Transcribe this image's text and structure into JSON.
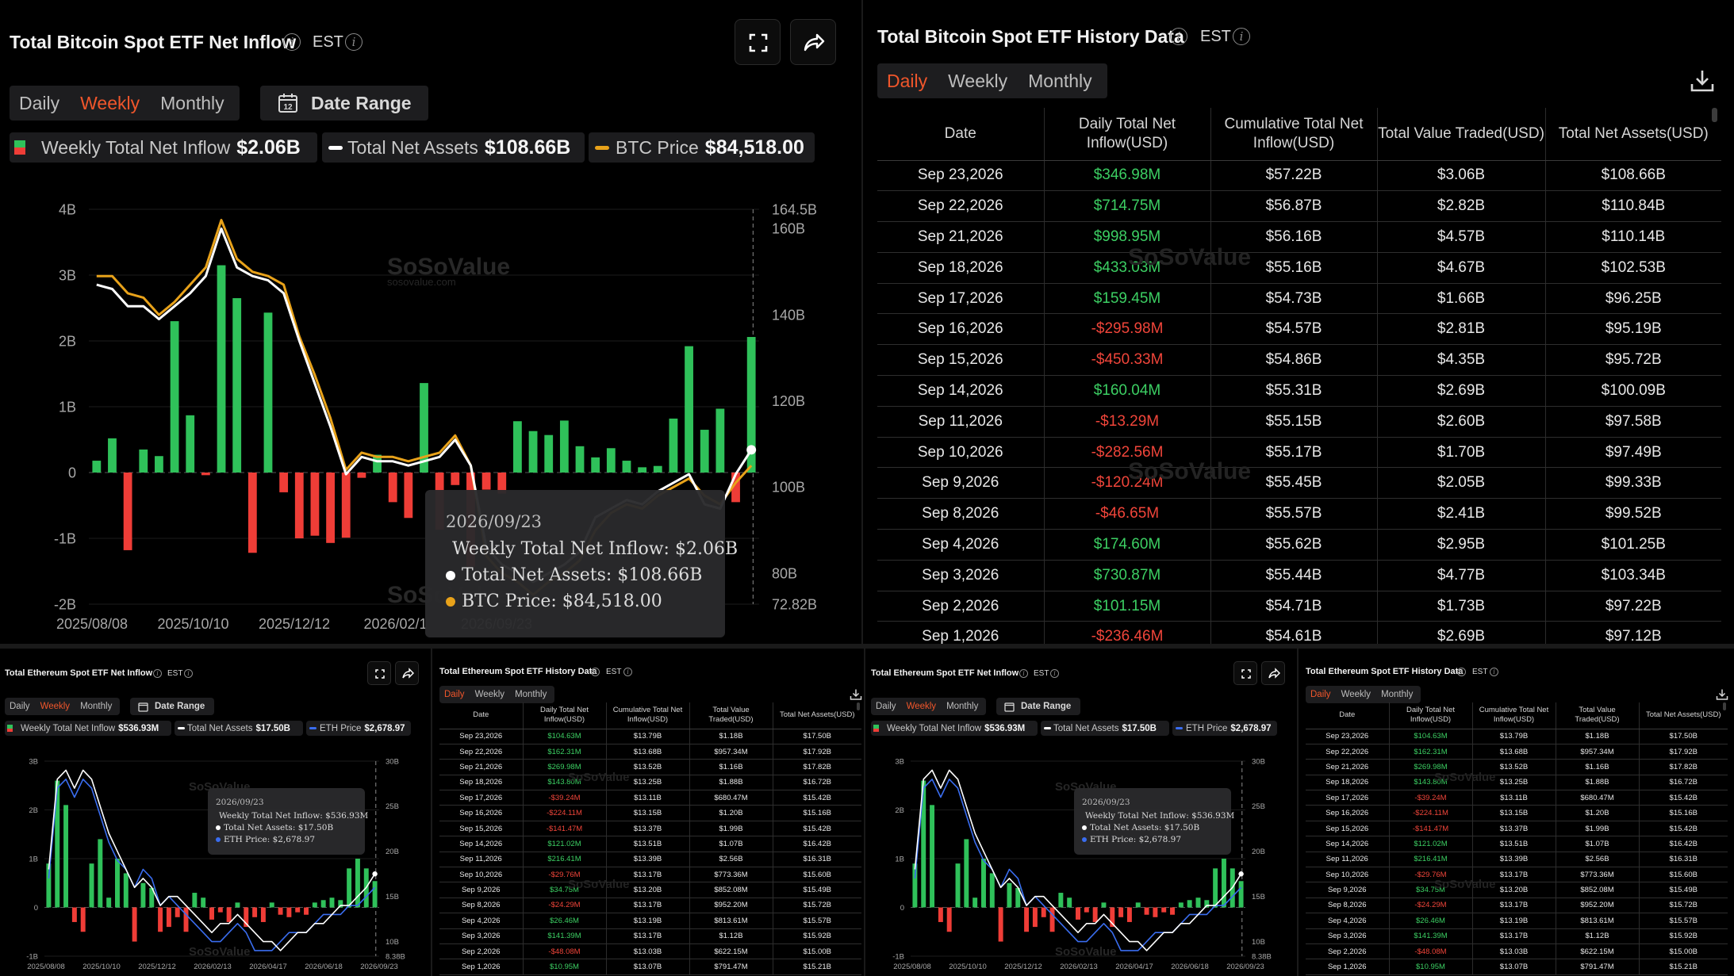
{
  "btc_chart": {
    "title": "Total Bitcoin Spot ETF Net Inflow",
    "tz": "EST",
    "tabs": [
      "Daily",
      "Weekly",
      "Monthly"
    ],
    "active_tab": "Weekly",
    "date_range": "Date Range",
    "calendar_day": "12",
    "legend": [
      {
        "label": "Weekly Total Net Inflow",
        "value": "$2.06B"
      },
      {
        "label": "Total Net Assets",
        "value": "$108.66B"
      },
      {
        "label": "BTC Price",
        "value": "$84,518.00"
      }
    ],
    "tooltip": {
      "date": "2026/09/23",
      "rows": [
        "Weekly Total Net Inflow: $2.06B",
        "Total Net Assets: $108.66B",
        "BTC Price: $84,518.00"
      ]
    },
    "watermark": "SoSoValue",
    "watermark_sub": "sosovalue.com",
    "colors": {
      "positive": "#2fc15a",
      "negative": "#ef3d37",
      "assets": "#ffffff",
      "price": "#e8a21a"
    }
  },
  "chart_data": [
    {
      "type": "bar",
      "title": "Total Bitcoin Spot ETF Net Inflow",
      "x_ticks": [
        "2025/08/08",
        "2025/10/10",
        "2025/12/12",
        "2026/02/1",
        "2026/09/23"
      ],
      "y_left_ticks": [
        "4B",
        "3B",
        "2B",
        "1B",
        "0",
        "-1B",
        "-2B"
      ],
      "y_left_lim": [
        -2,
        4
      ],
      "y_right_ticks": [
        "164.5B",
        "160B",
        "140B",
        "120B",
        "100B",
        "80B",
        "72.82B"
      ],
      "y_right_lim": [
        72.82,
        164.5
      ],
      "series": [
        {
          "name": "Weekly Total Net Inflow",
          "unit": "B USD",
          "values": [
            0.18,
            0.52,
            -1.18,
            0.35,
            0.25,
            2.3,
            0.87,
            -0.04,
            3.15,
            2.65,
            -1.22,
            2.43,
            -0.3,
            -1.0,
            -0.96,
            -1.07,
            -0.99,
            -0.08,
            0.27,
            -0.45,
            -0.69,
            1.36,
            -0.87,
            -0.19,
            -1.43,
            -0.26,
            -0.32,
            0.78,
            0.63,
            0.57,
            0.79,
            0.4,
            0.23,
            0.37,
            0.18,
            0.08,
            0.1,
            0.82,
            1.92,
            0.65,
            0.97,
            -0.45,
            2.06
          ]
        },
        {
          "name": "Total Net Assets",
          "unit": "B USD",
          "values": [
            147,
            146,
            142,
            142,
            139,
            142,
            145,
            149,
            160,
            151,
            149,
            148,
            145,
            134,
            124,
            114,
            103,
            107,
            106,
            106,
            105,
            106,
            107,
            111,
            105,
            86,
            82,
            80,
            78,
            80,
            82,
            85,
            93,
            95,
            97,
            96,
            99,
            101,
            103,
            96,
            95,
            103,
            108.66
          ]
        },
        {
          "name": "BTC Price",
          "unit": "B-scale",
          "values": [
            149,
            149,
            145,
            144,
            140,
            143,
            147,
            151,
            162,
            153,
            150,
            149,
            147,
            135,
            126,
            116,
            104,
            108,
            107,
            107,
            106,
            107,
            108,
            112,
            105,
            84,
            80,
            78,
            75,
            78,
            80,
            83,
            90,
            94,
            96,
            95,
            98,
            100,
            102,
            98,
            96,
            101,
            105
          ]
        }
      ]
    },
    {
      "type": "bar",
      "title": "Total Ethereum Spot ETF Net Inflow",
      "x_ticks": [
        "2025/08/08",
        "2025/10/10",
        "2025/12/12",
        "2026/02/13",
        "2026/04/17",
        "2026/06/18",
        "2026/09/23"
      ],
      "y_left_ticks": [
        "3B",
        "2B",
        "1B",
        "0",
        "-1B"
      ],
      "y_left_lim": [
        -1,
        3
      ],
      "y_right_ticks": [
        "30B",
        "25B",
        "20B",
        "15B",
        "10B",
        "8.38B"
      ],
      "y_right_lim": [
        8.38,
        30
      ],
      "series": [
        {
          "name": "Weekly Total Net Inflow",
          "unit": "B USD",
          "values": [
            0.9,
            2.6,
            2.1,
            -0.3,
            -0.5,
            0.9,
            1.4,
            0.2,
            1.0,
            0.7,
            -0.7,
            0.5,
            0.4,
            -0.5,
            -0.4,
            -0.2,
            -0.5,
            0.3,
            0.2,
            -0.25,
            -0.1,
            -0.3,
            0.1,
            -0.4,
            -0.2,
            -0.3,
            0.1,
            -0.15,
            -0.2,
            -0.1,
            -0.15,
            0.1,
            0.15,
            0.2,
            0.15,
            0.8,
            1.0,
            0.8,
            0.54
          ]
        },
        {
          "name": "Total Net Assets",
          "unit": "B USD",
          "values": [
            18,
            28,
            29,
            27,
            29,
            28,
            25,
            22,
            20,
            18,
            16,
            17,
            16,
            14,
            15,
            15,
            14,
            13,
            12,
            11,
            12,
            12,
            13,
            12,
            11,
            10,
            10,
            9,
            10,
            11,
            11,
            12,
            12,
            13,
            14,
            14,
            15,
            16,
            17.5
          ]
        },
        {
          "name": "ETH Price",
          "unit": "B-scale",
          "values": [
            17,
            27,
            28,
            26,
            28,
            27,
            24,
            21,
            19,
            18,
            16,
            18,
            17,
            14,
            15,
            14,
            13,
            12,
            11,
            10,
            10,
            11,
            12,
            11,
            9,
            9,
            9,
            10,
            11,
            11,
            11,
            12,
            13,
            13,
            13,
            14,
            14,
            15,
            16
          ]
        }
      ]
    }
  ],
  "btc_table": {
    "title": "Total Bitcoin Spot ETF History Data",
    "tz": "EST",
    "tabs": [
      "Daily",
      "Weekly",
      "Monthly"
    ],
    "active_tab": "Daily",
    "headers": [
      "Date",
      "Daily Total Net Inflow(USD)",
      "Cumulative Total Net Inflow(USD)",
      "Total Value Traded(USD)",
      "Total Net Assets(USD)"
    ],
    "rows": [
      [
        "Sep 23,2026",
        "$346.98M",
        "$57.22B",
        "$3.06B",
        "$108.66B"
      ],
      [
        "Sep 22,2026",
        "$714.75M",
        "$56.87B",
        "$2.82B",
        "$110.84B"
      ],
      [
        "Sep 21,2026",
        "$998.95M",
        "$56.16B",
        "$4.57B",
        "$110.14B"
      ],
      [
        "Sep 18,2026",
        "$433.03M",
        "$55.16B",
        "$4.67B",
        "$102.53B"
      ],
      [
        "Sep 17,2026",
        "$159.45M",
        "$54.73B",
        "$1.66B",
        "$96.25B"
      ],
      [
        "Sep 16,2026",
        "-$295.98M",
        "$54.57B",
        "$2.81B",
        "$95.19B"
      ],
      [
        "Sep 15,2026",
        "-$450.33M",
        "$54.86B",
        "$4.35B",
        "$95.72B"
      ],
      [
        "Sep 14,2026",
        "$160.04M",
        "$55.31B",
        "$2.69B",
        "$100.09B"
      ],
      [
        "Sep 11,2026",
        "-$13.29M",
        "$55.15B",
        "$2.60B",
        "$97.58B"
      ],
      [
        "Sep 10,2026",
        "-$282.56M",
        "$55.17B",
        "$1.70B",
        "$97.49B"
      ],
      [
        "Sep 9,2026",
        "-$120.24M",
        "$55.45B",
        "$2.05B",
        "$99.33B"
      ],
      [
        "Sep 8,2026",
        "-$46.65M",
        "$55.57B",
        "$2.41B",
        "$99.52B"
      ],
      [
        "Sep 4,2026",
        "$174.60M",
        "$55.62B",
        "$2.95B",
        "$101.25B"
      ],
      [
        "Sep 3,2026",
        "$730.87M",
        "$55.44B",
        "$4.77B",
        "$103.34B"
      ],
      [
        "Sep 2,2026",
        "$101.15M",
        "$54.71B",
        "$1.73B",
        "$97.22B"
      ],
      [
        "Sep 1,2026",
        "-$236.46M",
        "$54.61B",
        "$2.69B",
        "$97.12B"
      ]
    ]
  },
  "eth_chart": {
    "title": "Total Ethereum Spot ETF Net Inflow",
    "tz": "EST",
    "tabs": [
      "Daily",
      "Weekly",
      "Monthly"
    ],
    "active_tab": "Weekly",
    "date_range": "Date Range",
    "legend": [
      {
        "label": "Weekly Total Net Inflow",
        "value": "$536.93M"
      },
      {
        "label": "Total Net Assets",
        "value": "$17.50B"
      },
      {
        "label": "ETH Price",
        "value": "$2,678.97"
      }
    ],
    "tooltip": {
      "date": "2026/09/23",
      "rows": [
        "Weekly Total Net Inflow: $536.93M",
        "Total Net Assets: $17.50B",
        "ETH Price: $2,678.97"
      ]
    },
    "colors": {
      "positive": "#2fc15a",
      "negative": "#ef3d37",
      "assets": "#ffffff",
      "price": "#3a6df0"
    }
  },
  "eth_table": {
    "title": "Total Ethereum Spot ETF History Data",
    "tz": "EST",
    "tabs": [
      "Daily",
      "Weekly",
      "Monthly"
    ],
    "active_tab": "Daily",
    "headers": [
      "Date",
      "Daily Total Net Inflow(USD)",
      "Cumulative Total Net Inflow(USD)",
      "Total Value Traded(USD)",
      "Total Net Assets(USD)"
    ],
    "rows": [
      [
        "Sep 23,2026",
        "$104.63M",
        "$13.79B",
        "$1.18B",
        "$17.50B"
      ],
      [
        "Sep 22,2026",
        "$162.31M",
        "$13.68B",
        "$957.34M",
        "$17.92B"
      ],
      [
        "Sep 21,2026",
        "$269.98M",
        "$13.52B",
        "$1.16B",
        "$17.82B"
      ],
      [
        "Sep 18,2026",
        "$143.80M",
        "$13.25B",
        "$1.88B",
        "$16.72B"
      ],
      [
        "Sep 17,2026",
        "-$39.24M",
        "$13.11B",
        "$680.47M",
        "$15.42B"
      ],
      [
        "Sep 16,2026",
        "-$224.11M",
        "$13.15B",
        "$1.20B",
        "$15.16B"
      ],
      [
        "Sep 15,2026",
        "-$141.47M",
        "$13.37B",
        "$1.99B",
        "$15.42B"
      ],
      [
        "Sep 14,2026",
        "$121.02M",
        "$13.51B",
        "$1.07B",
        "$16.42B"
      ],
      [
        "Sep 11,2026",
        "$216.41M",
        "$13.39B",
        "$2.56B",
        "$16.31B"
      ],
      [
        "Sep 10,2026",
        "-$29.76M",
        "$13.17B",
        "$773.36M",
        "$15.60B"
      ],
      [
        "Sep 9,2026",
        "$34.75M",
        "$13.20B",
        "$852.08M",
        "$15.49B"
      ],
      [
        "Sep 8,2026",
        "-$24.29M",
        "$13.17B",
        "$952.20M",
        "$15.72B"
      ],
      [
        "Sep 4,2026",
        "$26.46M",
        "$13.19B",
        "$813.61M",
        "$15.57B"
      ],
      [
        "Sep 3,2026",
        "$141.39M",
        "$13.17B",
        "$1.12B",
        "$15.92B"
      ],
      [
        "Sep 2,2026",
        "-$48.08M",
        "$13.03B",
        "$622.15M",
        "$15.00B"
      ],
      [
        "Sep 1,2026",
        "$10.95M",
        "$13.07B",
        "$791.47M",
        "$15.21B"
      ]
    ]
  }
}
